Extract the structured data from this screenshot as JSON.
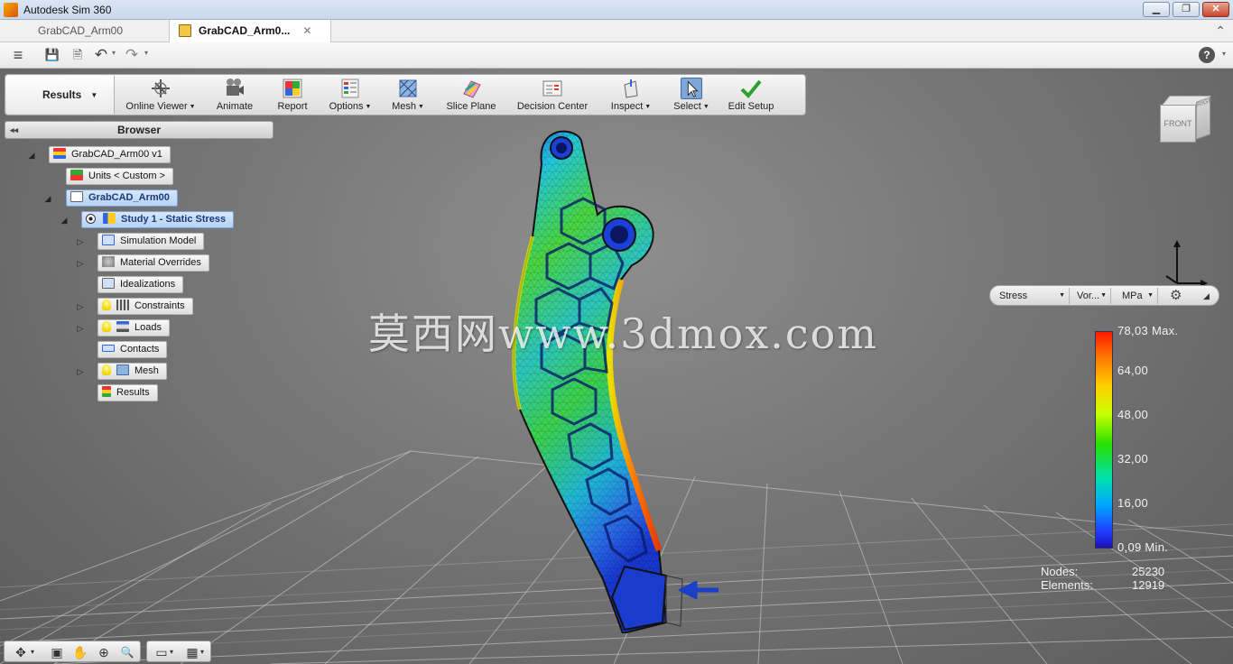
{
  "window": {
    "title": "Autodesk Sim 360",
    "controls": {
      "minimize": "▁",
      "restore": "❐",
      "close": "✕"
    }
  },
  "tabs": [
    {
      "label": "GrabCAD_Arm00",
      "active": false
    },
    {
      "label": "GrabCAD_Arm0...",
      "active": true,
      "close": "✕"
    }
  ],
  "qat": {
    "menu_icon": "≡",
    "save_icon": "💾",
    "saveas_icon": "🗎",
    "undo_icon": "↶",
    "redo_icon": "↷",
    "dropdown": "▾",
    "help": "?",
    "collapse": "⌃"
  },
  "ribbon": {
    "workspace": "Results",
    "workspace_caret": "▼",
    "buttons": [
      {
        "label": "Online Viewer",
        "dropdown": true,
        "icon": "online-viewer-icon"
      },
      {
        "label": "Animate",
        "dropdown": false,
        "icon": "animate-icon"
      },
      {
        "label": "Report",
        "dropdown": false,
        "icon": "report-icon"
      },
      {
        "label": "Options",
        "dropdown": true,
        "icon": "options-icon"
      },
      {
        "label": "Mesh",
        "dropdown": true,
        "icon": "mesh-icon"
      },
      {
        "label": "Slice Plane",
        "dropdown": false,
        "icon": "slice-plane-icon"
      },
      {
        "label": "Decision Center",
        "dropdown": false,
        "icon": "decision-center-icon"
      },
      {
        "label": "Inspect",
        "dropdown": true,
        "icon": "inspect-icon"
      },
      {
        "label": "Select",
        "dropdown": true,
        "icon": "select-icon"
      },
      {
        "label": "Edit Setup",
        "dropdown": false,
        "icon": "edit-setup-icon"
      }
    ],
    "dropdown_mark": "▼"
  },
  "browser": {
    "title": "Browser",
    "collapse": "◂◂",
    "tree": [
      {
        "label": "GrabCAD_Arm00 v1",
        "expander": "◢"
      },
      {
        "label": "Units < Custom >"
      },
      {
        "label": "GrabCAD_Arm00",
        "expander": "◢"
      },
      {
        "label": "Study 1 - Static Stress",
        "expander": "◢"
      },
      {
        "label": "Simulation Model",
        "expander": "▷"
      },
      {
        "label": "Material Overrides",
        "expander": "▷"
      },
      {
        "label": "Idealizations"
      },
      {
        "label": "Constraints",
        "expander": "▷"
      },
      {
        "label": "Loads",
        "expander": "▷"
      },
      {
        "label": "Contacts"
      },
      {
        "label": "Mesh",
        "expander": "▷"
      },
      {
        "label": "Results"
      }
    ]
  },
  "viewcube": {
    "front": "FRONT",
    "right": "RIGHT"
  },
  "legend": {
    "result_type": "Stress",
    "component": "Vor...",
    "unit": "MPa",
    "dropdown": "▼",
    "settings_icon": "⚙",
    "pin_icon": "◢",
    "ticks": [
      "78,03 Max.",
      "64,00",
      "48,00",
      "32,00",
      "16,00",
      "0,09 Min."
    ]
  },
  "stats": {
    "nodes_label": "Nodes:",
    "nodes_value": "25230",
    "elements_label": "Elements:",
    "elements_value": "12919"
  },
  "watermark": "莫西网www.3dmox.com",
  "navbar": {
    "orbit": "✥",
    "look": "▣",
    "pan": "✋",
    "zoom_window": "⊕",
    "zoom": "🔍",
    "display": "▭",
    "grid": "▦",
    "dropdown": "▾"
  }
}
